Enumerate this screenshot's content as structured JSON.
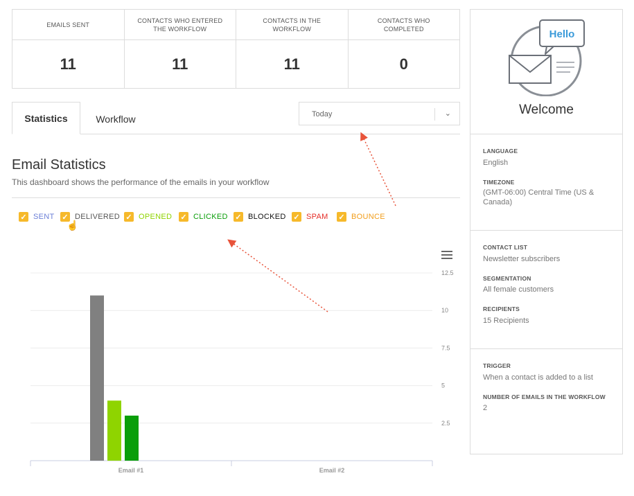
{
  "stats": [
    {
      "label": "EMAILS SENT",
      "value": "11"
    },
    {
      "label": "CONTACTS WHO ENTERED THE WORKFLOW",
      "value": "11"
    },
    {
      "label": "CONTACTS IN THE WORKFLOW",
      "value": "11"
    },
    {
      "label": "CONTACTS WHO COMPLETED",
      "value": "0"
    }
  ],
  "tabs": {
    "statistics": "Statistics",
    "workflow": "Workflow"
  },
  "range_select": {
    "value": "Today"
  },
  "section": {
    "title": "Email Statistics",
    "subtitle": "This dashboard shows the performance of the emails in your workflow"
  },
  "legend": [
    {
      "label": "SENT",
      "color": "#6b7fd7",
      "checked": true
    },
    {
      "label": "DELIVERED",
      "color": "#555555",
      "checked": true
    },
    {
      "label": "OPENED",
      "color": "#8fd400",
      "checked": true
    },
    {
      "label": "CLICKED",
      "color": "#0a9e0a",
      "checked": true
    },
    {
      "label": "BLOCKED",
      "color": "#111111",
      "checked": true
    },
    {
      "label": "SPAM",
      "color": "#e52d27",
      "checked": true
    },
    {
      "label": "BOUNCE",
      "color": "#f29d1a",
      "checked": true
    }
  ],
  "chart_data": {
    "type": "bar",
    "categories": [
      "Email #1",
      "Email #2"
    ],
    "series": [
      {
        "name": "DELIVERED",
        "color": "#808080",
        "values": [
          11,
          0
        ]
      },
      {
        "name": "OPENED",
        "color": "#8fd400",
        "values": [
          4,
          0
        ]
      },
      {
        "name": "CLICKED",
        "color": "#0a9e0a",
        "values": [
          3,
          0
        ]
      }
    ],
    "y_ticks": [
      "2.5",
      "5",
      "7.5",
      "10",
      "12.5"
    ],
    "ylim": [
      0,
      12.5
    ],
    "grid": true,
    "legend": "top-left"
  },
  "sidebar": {
    "hello": "Hello",
    "welcome": "Welcome",
    "language_label": "LANGUAGE",
    "language": "English",
    "timezone_label": "TIMEZONE",
    "timezone": "(GMT-06:00) Central Time (US & Canada)",
    "contact_list_label": "CONTACT LIST",
    "contact_list": "Newsletter subscribers",
    "segmentation_label": "SEGMENTATION",
    "segmentation": "All female customers",
    "recipients_label": "RECIPIENTS",
    "recipients": "15 Recipients",
    "trigger_label": "TRIGGER",
    "trigger": "When a contact is added to a list",
    "num_emails_label": "NUMBER OF EMAILS IN THE WORKFLOW",
    "num_emails": "2"
  },
  "colors": {
    "accent": "#f6b92b",
    "annotation_arrow": "#e8533a",
    "hello_text": "#3a9ad9"
  }
}
